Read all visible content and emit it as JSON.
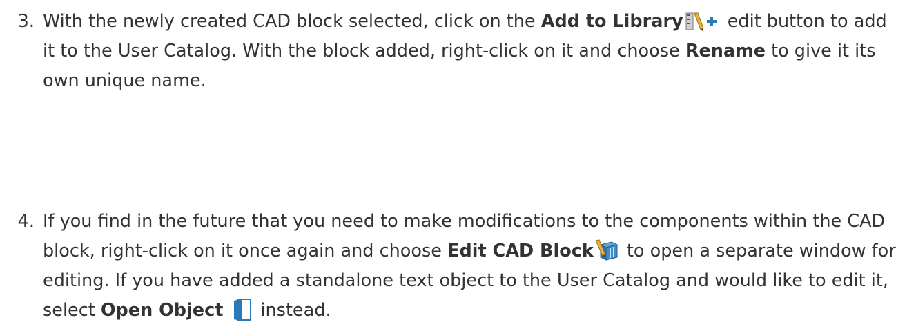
{
  "steps": [
    {
      "number": "3.",
      "parts": {
        "p1": "With the newly created CAD block selected, click on the ",
        "b1": "Add to Library",
        "icon1": "add-to-library-icon",
        "p2": " edit button to add it to the User Catalog. With the block added, right-click on it and choose ",
        "b2": "Rename",
        "p3": " to give it its own unique name."
      }
    },
    {
      "number": "4.",
      "parts": {
        "p1": "If you find in the future that you need to make modifications to the components within the CAD block, right-click on it once again and choose ",
        "b1": "Edit CAD Block",
        "icon1": "edit-cad-block-icon",
        "p2": " to open a separate window for editing. If you have added a standalone text object to the User Catalog and would like to edit it, select ",
        "b2": "Open Object",
        "icon2": "open-object-icon",
        "p3": "instead."
      }
    }
  ],
  "colors": {
    "text": "#333333",
    "icon_blue": "#2a7ab8",
    "icon_yellow": "#d9a62e"
  }
}
